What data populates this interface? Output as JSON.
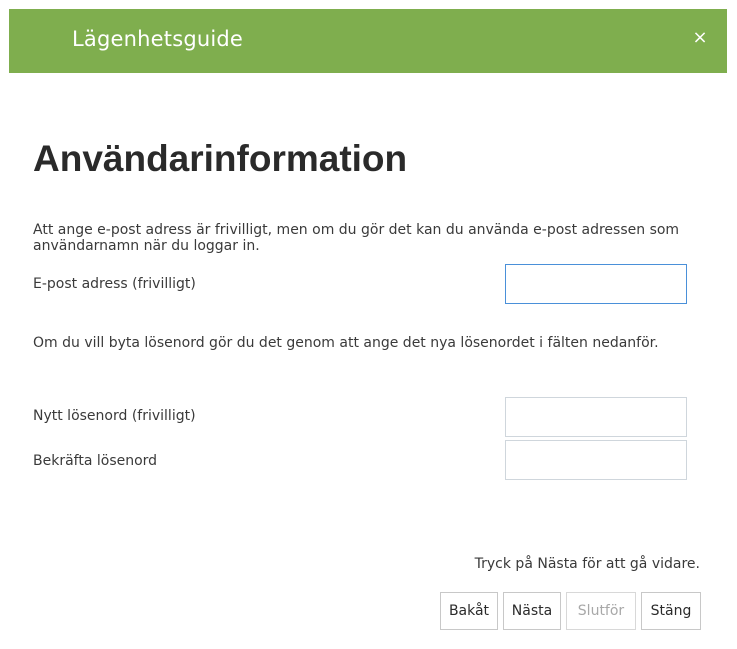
{
  "window": {
    "title": "Lägenhetsguide",
    "close_label": "×"
  },
  "page": {
    "heading": "Användarinformation",
    "email_intro": "Att ange e-post adress är frivilligt, men om du gör det kan du använda e-post adressen som användarnamn när du loggar in.",
    "email_label": "E-post adress (frivilligt)",
    "email_value": "",
    "password_intro": "Om du vill byta lösenord gör du det genom att ange det nya lösenordet i fälten nedanför.",
    "new_password_label": "Nytt lösenord (frivilligt)",
    "new_password_value": "",
    "confirm_password_label": "Bekräfta lösenord",
    "confirm_password_value": ""
  },
  "footer": {
    "hint": "Tryck på Nästa för att gå vidare.",
    "buttons": {
      "back": "Bakåt",
      "next": "Nästa",
      "finish": "Slutför",
      "close": "Stäng"
    }
  },
  "colors": {
    "titlebar": "#7fae4e",
    "focus_border": "#4a90d9"
  }
}
